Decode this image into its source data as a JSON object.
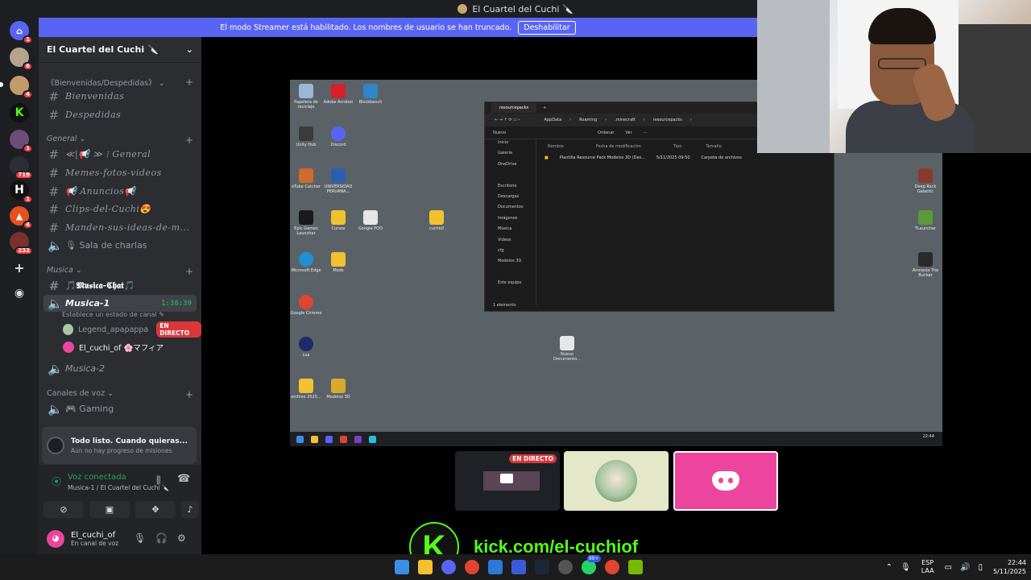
{
  "window": {
    "title": "El Cuartel del Cuchi 🔪"
  },
  "banner": {
    "text": "El modo Streamer está habilitado. Los nombres de usuario se han truncado.",
    "button": "Deshabilitar"
  },
  "servers": [
    {
      "badge": "",
      "color": "#5865f2"
    },
    {
      "badge": "1",
      "color": "#b5a48b"
    },
    {
      "badge": "6",
      "color": "#7a8fa8"
    },
    {
      "badge": "4",
      "color": "#c49a6c"
    },
    {
      "badge": "",
      "color": "#111111"
    },
    {
      "badge": "1",
      "color": "#6e4d7a"
    },
    {
      "badge": "719",
      "color": "#2d2d36"
    },
    {
      "badge": "1",
      "color": "#111111"
    },
    {
      "badge": "4",
      "color": "#e8501f"
    },
    {
      "badge": "232",
      "color": "#7a3030"
    }
  ],
  "sidebar": {
    "guild_name": "El Cuartel del Cuchi 🔪",
    "categories": {
      "welcome": "《Bienvenidas/Despedidas》",
      "general": "General",
      "musica": "Musica",
      "voz": "Canales de voz"
    },
    "channels": {
      "bienvenidas": "Bienvenidas",
      "despedidas": "Despedidas",
      "general": "≪|📢 ≫ ⁝ General",
      "memes": "Memes-fotos-videos",
      "anuncios": "📢 Anuncios📢",
      "clips": "Clips-del-Cuchi😍",
      "manden": "Manden-sus-ideas-de-m...",
      "sala": "🎙 Sala de charlas",
      "musica_chat": "🎵𝕸𝖚𝖘𝖎𝖈𝖆-𝕮𝖍𝖆𝖙🎵",
      "musica1": "Musica-1",
      "musica1_timer": "1:36:39",
      "musica1_status": "Establece un estado de canal ✎",
      "musica2": "Musica-2",
      "gaming": "🎮 Gaming"
    },
    "voice_users": [
      {
        "name": "Legend_apapappa",
        "live": "EN DIRECTO"
      },
      {
        "name": "El_cuchi_of 🌸マフィア",
        "live": ""
      }
    ]
  },
  "quest": {
    "title": "Todo listo. Cuando quieras...",
    "subtitle": "Aún no hay progreso de misiones"
  },
  "voice": {
    "status": "Voz conectada",
    "where": "Musica-1 / El Cuartel del Cuchi 🔪"
  },
  "account": {
    "name": "El_cuchi_of",
    "status": "En canal de voz"
  },
  "stream": {
    "desktop_icons": [
      "Papelera de reciclaje",
      "Adobe Acrobat",
      "Blockbench",
      "Unity Hub",
      "Discord",
      "eTube Catcher",
      "UNIVERSIDAD PERUANA...",
      "Epic Games Launcher",
      "Cursos",
      "Google POO",
      "cuchiof",
      "Microsoft Edge",
      "Mods",
      "Google Chrome",
      "Lua",
      "Nuevo Documento...",
      "archivo 2025...",
      "Modelos 3D",
      "Deep Rock Galactic",
      "TLauncher",
      "Amnesia The Bunker"
    ],
    "explorer": {
      "tab": "resourcepacks",
      "path": [
        "AppData",
        "Roaming",
        ".minecraft",
        "resourcepacks"
      ],
      "tools": [
        "Nuevo",
        "Ordenar",
        "Ver",
        "···"
      ],
      "nav": [
        "Inicio",
        "Galería",
        "OneDrive",
        "",
        "Escritorio",
        "Descargas",
        "Documentos",
        "Imágenes",
        "Música",
        "Videos",
        "cfg",
        "Modelos 3D",
        "",
        "Este equipo"
      ],
      "columns": [
        "Nombre",
        "Fecha de modificación",
        "Tipo",
        "Tamaño"
      ],
      "row": [
        "Plantilla Resource Pack Modelos 3D (Des...",
        "5/11/2025 09:50",
        "Carpeta de archivos"
      ],
      "footer": "1 elemento"
    },
    "inner_clock": "22:44"
  },
  "thumbs": {
    "live": "EN DIRECTO"
  },
  "kick": {
    "letter": "K",
    "url": "kick.com/el-cuchiof"
  },
  "taskbar": {
    "badge": "99+",
    "lang": "ESP",
    "lang2": "LAA",
    "time": "22:44",
    "date": "5/11/2025"
  }
}
